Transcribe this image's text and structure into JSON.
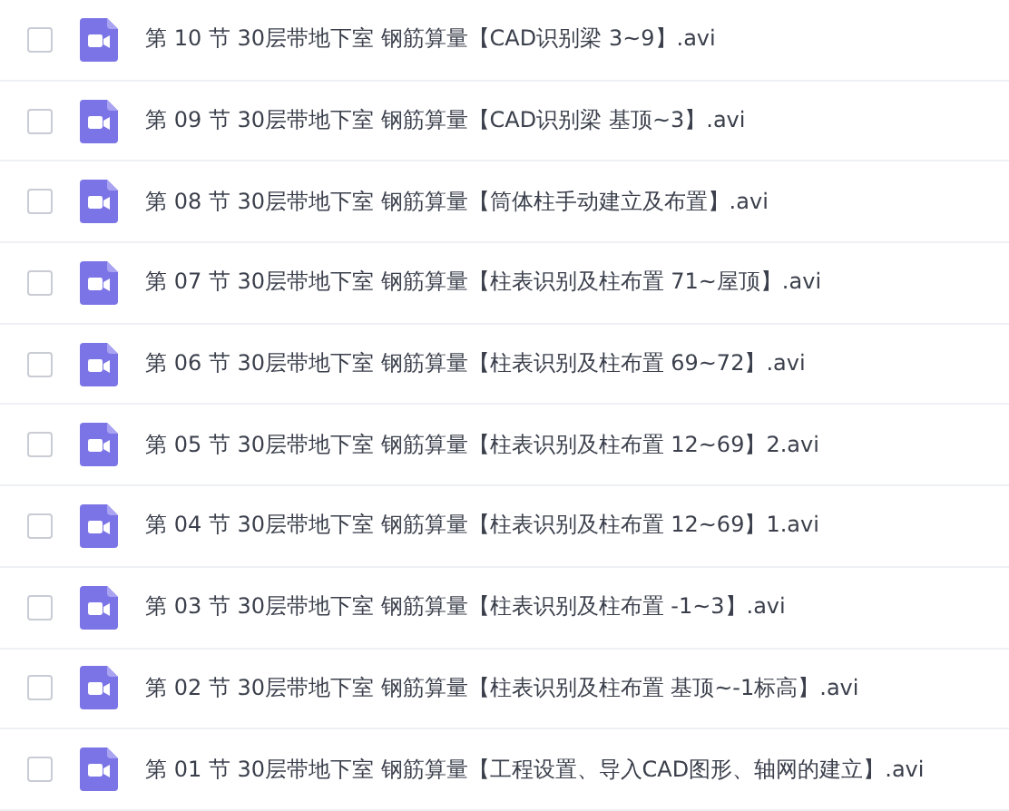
{
  "files": [
    {
      "name": "第 10 节 30层带地下室 钢筋算量【CAD识别梁 3~9】.avi",
      "checked": false
    },
    {
      "name": "第 09 节 30层带地下室 钢筋算量【CAD识别梁 基顶~3】.avi",
      "checked": false
    },
    {
      "name": "第 08 节 30层带地下室 钢筋算量【筒体柱手动建立及布置】.avi",
      "checked": false
    },
    {
      "name": "第 07 节 30层带地下室 钢筋算量【柱表识别及柱布置 71~屋顶】.avi",
      "checked": false
    },
    {
      "name": "第 06 节 30层带地下室 钢筋算量【柱表识别及柱布置 69~72】.avi",
      "checked": false
    },
    {
      "name": "第 05 节 30层带地下室 钢筋算量【柱表识别及柱布置 12~69】2.avi",
      "checked": false
    },
    {
      "name": "第 04 节 30层带地下室 钢筋算量【柱表识别及柱布置 12~69】1.avi",
      "checked": false
    },
    {
      "name": "第 03 节 30层带地下室 钢筋算量【柱表识别及柱布置 -1~3】.avi",
      "checked": false
    },
    {
      "name": "第 02 节 30层带地下室 钢筋算量【柱表识别及柱布置 基顶~-1标高】.avi",
      "checked": false
    },
    {
      "name": "第 01 节 30层带地下室 钢筋算量【工程设置、导入CAD图形、轴网的建立】.avi",
      "checked": false
    }
  ]
}
